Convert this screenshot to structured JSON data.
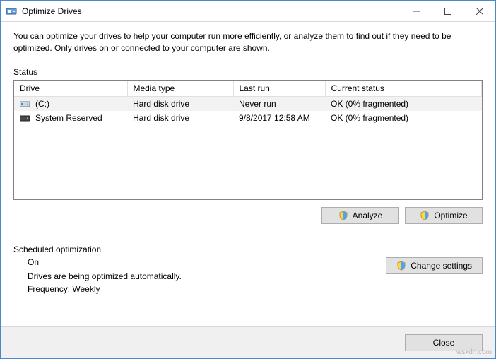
{
  "window": {
    "title": "Optimize Drives"
  },
  "description": "You can optimize your drives to help your computer run more efficiently, or analyze them to find out if they need to be optimized. Only drives on or connected to your computer are shown.",
  "status_label": "Status",
  "table": {
    "headers": {
      "drive": "Drive",
      "media": "Media type",
      "lastrun": "Last run",
      "status": "Current status"
    },
    "rows": [
      {
        "name": "(C:)",
        "media": "Hard disk drive",
        "lastrun": "Never run",
        "status": "OK (0% fragmented)",
        "icon": "drive-c"
      },
      {
        "name": "System Reserved",
        "media": "Hard disk drive",
        "lastrun": "9/8/2017 12:58 AM",
        "status": "OK (0% fragmented)",
        "icon": "drive"
      }
    ]
  },
  "buttons": {
    "analyze": "Analyze",
    "optimize": "Optimize",
    "change_settings": "Change settings",
    "close": "Close"
  },
  "scheduled": {
    "label": "Scheduled optimization",
    "state": "On",
    "line1": "Drives are being optimized automatically.",
    "line2": "Frequency: Weekly"
  },
  "watermark": "wsxdn.com"
}
